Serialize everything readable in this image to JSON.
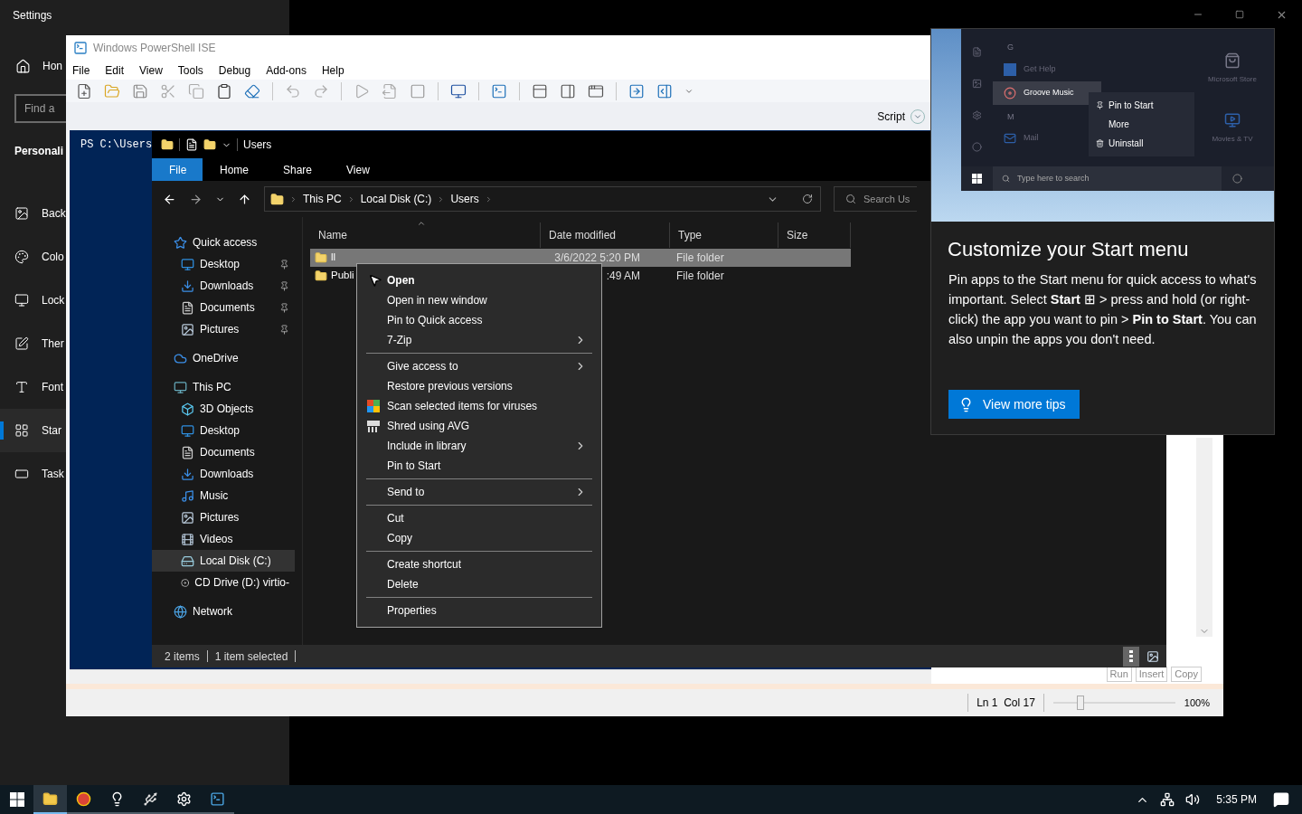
{
  "settings_window": {
    "title": "Settings",
    "home": "Hon",
    "search": {
      "placeholder": "Find a"
    },
    "section": "Personali",
    "items": [
      {
        "label": "Back",
        "kind": "background",
        "selected": false
      },
      {
        "label": "Colo",
        "kind": "colors",
        "selected": false
      },
      {
        "label": "Lock",
        "kind": "lock-screen",
        "selected": false
      },
      {
        "label": "Ther",
        "kind": "themes",
        "selected": false
      },
      {
        "label": "Font",
        "kind": "fonts",
        "selected": false
      },
      {
        "label": "Star",
        "kind": "start",
        "selected": true
      },
      {
        "label": "Task",
        "kind": "taskbar",
        "selected": false
      }
    ]
  },
  "powershell_ise": {
    "title": "Windows PowerShell ISE",
    "menu": [
      "File",
      "Edit",
      "View",
      "Tools",
      "Debug",
      "Add-ons",
      "Help"
    ],
    "script_toggle": "Script",
    "console_prompt": "PS C:\\Users",
    "pane_buttons": [
      "Run",
      "Insert",
      "Copy"
    ],
    "status": {
      "position": "Ln 1  Col 17",
      "zoom": "100%",
      "zoom_slider": {
        "level": 0.22
      }
    }
  },
  "file_explorer": {
    "title": "Users",
    "ribbon_tabs": [
      {
        "label": "File",
        "selected": true
      },
      {
        "label": "Home",
        "selected": false
      },
      {
        "label": "Share",
        "selected": false
      },
      {
        "label": "View",
        "selected": false
      }
    ],
    "breadcrumb": [
      "This PC",
      "Local Disk (C:)",
      "Users"
    ],
    "search": {
      "placeholder": "Search Us"
    },
    "navigation": [
      {
        "label": "Quick access",
        "kind": "quick-access",
        "selected": false,
        "children": [
          {
            "label": "Desktop",
            "kind": "desktop",
            "pinned": true,
            "selected": false
          },
          {
            "label": "Downloads",
            "kind": "downloads",
            "pinned": true,
            "selected": false
          },
          {
            "label": "Documents",
            "kind": "documents",
            "pinned": true,
            "selected": false
          },
          {
            "label": "Pictures",
            "kind": "pictures",
            "pinned": true,
            "selected": false
          }
        ]
      },
      {
        "label": "OneDrive",
        "kind": "onedrive",
        "selected": false
      },
      {
        "label": "This PC",
        "kind": "pc",
        "selected": false,
        "children": [
          {
            "label": "3D Objects",
            "kind": "objects",
            "pinned": false,
            "selected": false
          },
          {
            "label": "Desktop",
            "kind": "desktop",
            "pinned": false,
            "selected": false
          },
          {
            "label": "Documents",
            "kind": "documents",
            "pinned": false,
            "selected": false
          },
          {
            "label": "Downloads",
            "kind": "downloads",
            "pinned": false,
            "selected": false
          },
          {
            "label": "Music",
            "kind": "music",
            "pinned": false,
            "selected": false
          },
          {
            "label": "Pictures",
            "kind": "pictures",
            "pinned": false,
            "selected": false
          },
          {
            "label": "Videos",
            "kind": "videos",
            "pinned": false,
            "selected": false
          },
          {
            "label": "Local Disk (C:)",
            "kind": "disk",
            "pinned": false,
            "selected": true
          },
          {
            "label": "CD Drive (D:) virtio-",
            "kind": "cd",
            "pinned": false,
            "selected": false
          }
        ]
      },
      {
        "label": "Network",
        "kind": "network",
        "selected": false
      }
    ],
    "columns": [
      "Name",
      "Date modified",
      "Type",
      "Size"
    ],
    "rows": [
      {
        "name": "ll",
        "date": "3/6/2022 5:20 PM",
        "type": "File folder",
        "selected": true
      },
      {
        "name": "Publi",
        "date": ":49 AM",
        "type": "File folder",
        "selected": false
      }
    ],
    "status": [
      "2 items",
      "1 item selected"
    ]
  },
  "context_menu": {
    "groups": [
      [
        {
          "label": "Open",
          "kind": "text",
          "default": true,
          "submenu": false
        },
        {
          "label": "Open in new window",
          "kind": "text",
          "default": false,
          "submenu": false
        },
        {
          "label": "Pin to Quick access",
          "kind": "text",
          "default": false,
          "submenu": false
        },
        {
          "label": "7-Zip",
          "kind": "text",
          "default": false,
          "submenu": true
        }
      ],
      [
        {
          "label": "Give access to",
          "kind": "text",
          "default": false,
          "submenu": true
        },
        {
          "label": "Restore previous versions",
          "kind": "text",
          "default": false,
          "submenu": false
        },
        {
          "label": "Scan selected items for viruses",
          "kind": "scan",
          "default": false,
          "submenu": false
        },
        {
          "label": "Shred using AVG",
          "kind": "shred",
          "default": false,
          "submenu": false
        },
        {
          "label": "Include in library",
          "kind": "text",
          "default": false,
          "submenu": true
        },
        {
          "label": "Pin to Start",
          "kind": "text",
          "default": false,
          "submenu": false
        }
      ],
      [
        {
          "label": "Send to",
          "kind": "text",
          "default": false,
          "submenu": true
        }
      ],
      [
        {
          "label": "Cut",
          "kind": "text",
          "default": false,
          "submenu": false
        },
        {
          "label": "Copy",
          "kind": "text",
          "default": false,
          "submenu": false
        }
      ],
      [
        {
          "label": "Create shortcut",
          "kind": "text",
          "default": false,
          "submenu": false
        },
        {
          "label": "Delete",
          "kind": "text",
          "default": false,
          "submenu": false
        }
      ],
      [
        {
          "label": "Properties",
          "kind": "text",
          "default": false,
          "submenu": false
        }
      ]
    ]
  },
  "tip_panel": {
    "preview": {
      "letters": [
        "G",
        "M"
      ],
      "apps": [
        "Get Help",
        "Groove Music",
        "Mail"
      ],
      "menu": [
        "Pin to Start",
        "More",
        "Uninstall"
      ],
      "tiles": [
        "Microsoft Store",
        "Movies & TV"
      ],
      "search_placeholder": "Type here to search"
    },
    "heading": "Customize your Start menu",
    "text": "Pin apps to the Start menu for quick access to what's important. Select **Start** ⊞ > press and hold (or right-click) the app you want to pin > **Pin to Start**. You can also unpin the apps you don't need.",
    "button": "View more tips"
  },
  "taskbar": {
    "apps": [
      {
        "kind": "explorer",
        "selected": true
      },
      {
        "kind": "chrome",
        "selected": false
      },
      {
        "kind": "tips",
        "selected": false
      },
      {
        "kind": "usb",
        "selected": false
      },
      {
        "kind": "settings",
        "selected": false
      },
      {
        "kind": "powershell",
        "selected": false
      }
    ],
    "time": "5:35 PM"
  }
}
